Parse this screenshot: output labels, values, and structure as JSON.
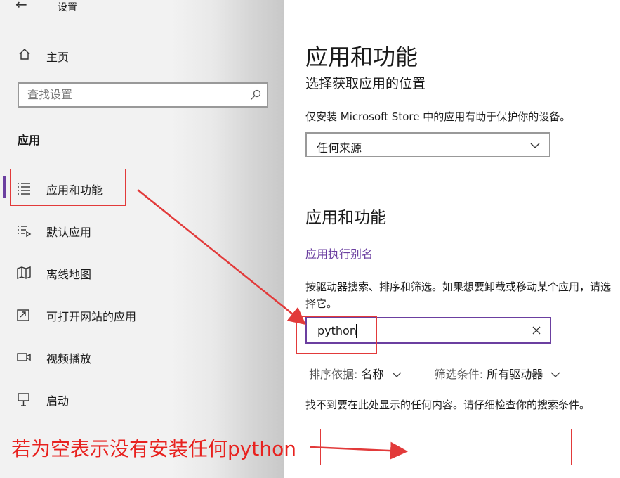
{
  "window": {
    "title": "设置"
  },
  "sidebar": {
    "home_label": "主页",
    "search_placeholder": "查找设置",
    "section_label": "应用",
    "items": [
      {
        "label": "应用和功能",
        "icon": "list-icon",
        "active": true
      },
      {
        "label": "默认应用",
        "icon": "default-apps-icon",
        "active": false
      },
      {
        "label": "离线地图",
        "icon": "map-icon",
        "active": false
      },
      {
        "label": "可打开网站的应用",
        "icon": "open-website-icon",
        "active": false
      },
      {
        "label": "视频播放",
        "icon": "video-icon",
        "active": false
      },
      {
        "label": "启动",
        "icon": "startup-icon",
        "active": false
      }
    ]
  },
  "main": {
    "title": "应用和功能",
    "choose_location_heading": "选择获取应用的位置",
    "store_description": "仅安装 Microsoft Store 中的应用有助于保护你的设备。",
    "source_select_value": "任何来源",
    "apps_heading": "应用和功能",
    "alias_link": "应用执行别名",
    "search_description": "按驱动器搜索、排序和筛选。如果想要卸载或移动某个应用，请选择它。",
    "filter_value": "python",
    "sort_label": "排序依据:",
    "sort_value": "名称",
    "filter_label": "筛选条件:",
    "filter_drive_value": "所有驱动器",
    "no_results": "找不到要在此处显示的任何内容。请仔细检查你的搜索条件。"
  },
  "annotation": {
    "text": "若为空表示没有安装任何python",
    "color": "#e8221f"
  },
  "colors": {
    "accent": "#6b3fa0",
    "annotation_red": "#e23a3a"
  }
}
